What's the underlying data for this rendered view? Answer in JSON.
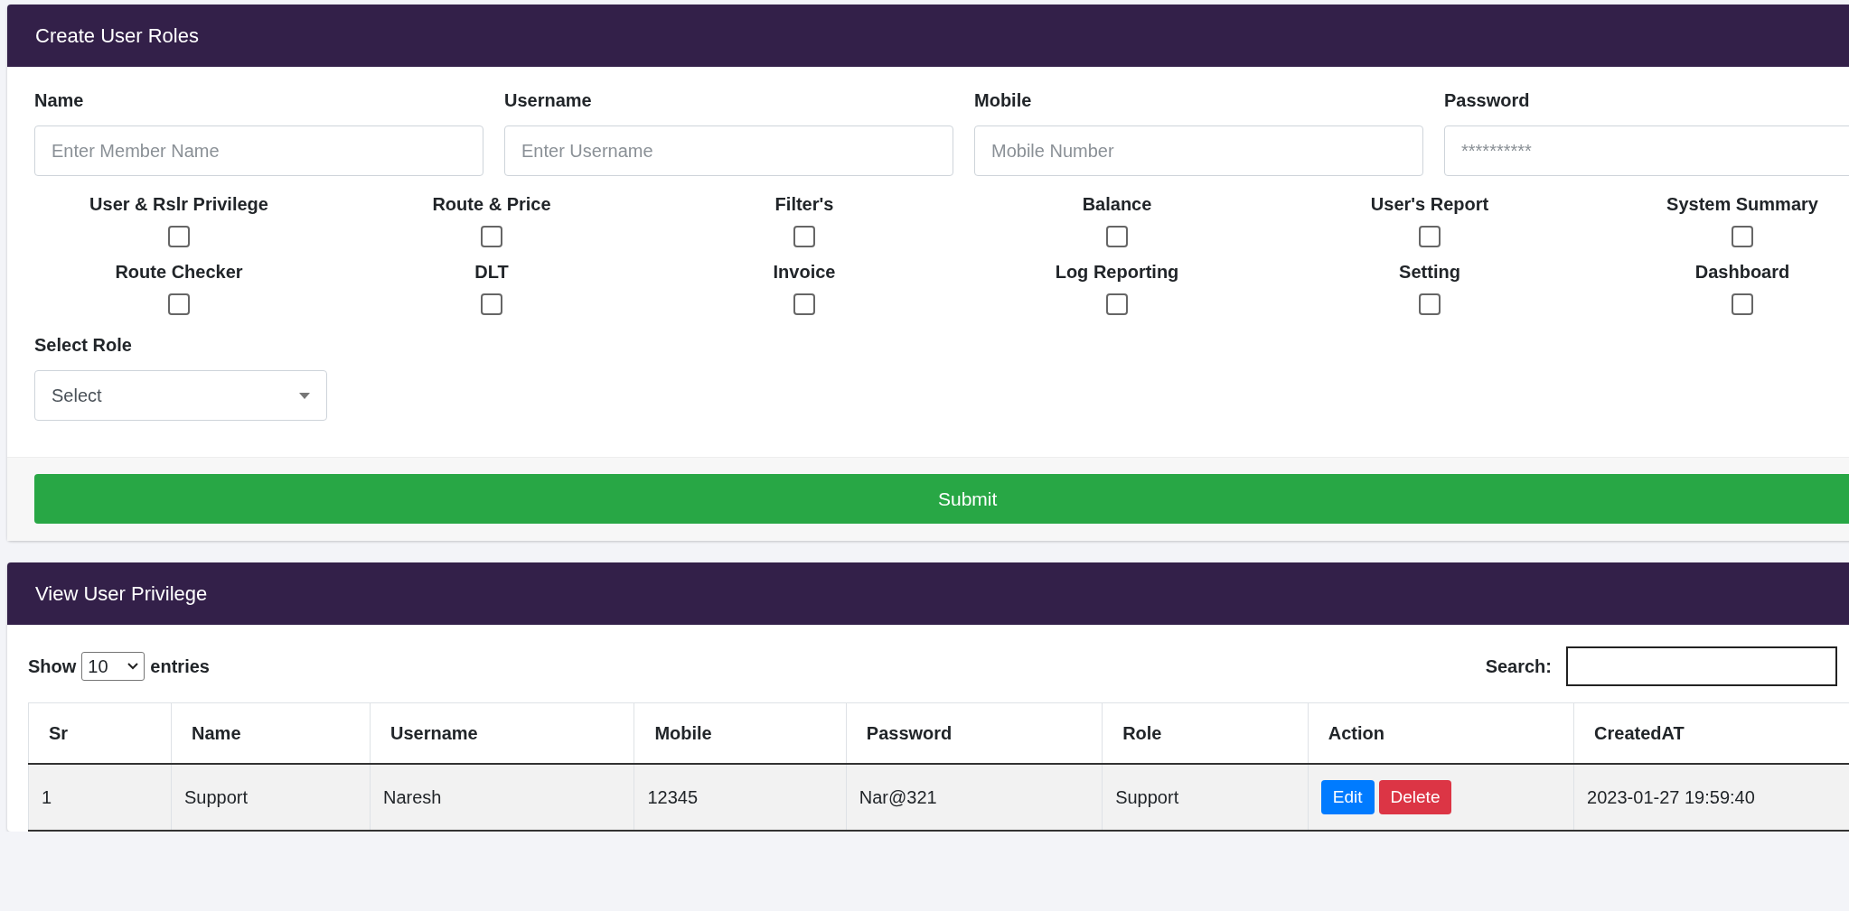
{
  "create_card": {
    "title": "Create User Roles",
    "fields": [
      {
        "label": "Name",
        "placeholder": "Enter Member Name"
      },
      {
        "label": "Username",
        "placeholder": "Enter Username"
      },
      {
        "label": "Mobile",
        "placeholder": "Mobile Number"
      },
      {
        "label": "Password",
        "placeholder": "**********"
      }
    ],
    "privileges": [
      {
        "label": "User & Rslr Privilege",
        "checked": false
      },
      {
        "label": "Route & Price",
        "checked": false
      },
      {
        "label": "Filter's",
        "checked": false
      },
      {
        "label": "Balance",
        "checked": false
      },
      {
        "label": "User's Report",
        "checked": false
      },
      {
        "label": "System Summary",
        "checked": false
      },
      {
        "label": "Route Checker",
        "checked": false
      },
      {
        "label": "DLT",
        "checked": false
      },
      {
        "label": "Invoice",
        "checked": false
      },
      {
        "label": "Log Reporting",
        "checked": false
      },
      {
        "label": "Setting",
        "checked": false
      },
      {
        "label": "Dashboard",
        "checked": false
      }
    ],
    "role_select": {
      "label": "Select Role",
      "value": "Select"
    },
    "submit": "Submit"
  },
  "view_card": {
    "title": "View User Privilege",
    "length": {
      "prefix": "Show",
      "value": "10",
      "suffix": "entries"
    },
    "search": {
      "label": "Search:"
    },
    "table": {
      "columns": [
        "Sr",
        "Name",
        "Username",
        "Mobile",
        "Password",
        "Role",
        "Action",
        "CreatedAT"
      ],
      "rows": [
        {
          "cells": [
            "1",
            "Support",
            "Naresh",
            "12345",
            "Nar@321",
            "Support"
          ],
          "actions": [
            {
              "kind": "edit",
              "label": "Edit"
            },
            {
              "kind": "delete",
              "label": "Delete"
            }
          ],
          "created": "2023-01-27 19:59:40"
        }
      ]
    }
  }
}
